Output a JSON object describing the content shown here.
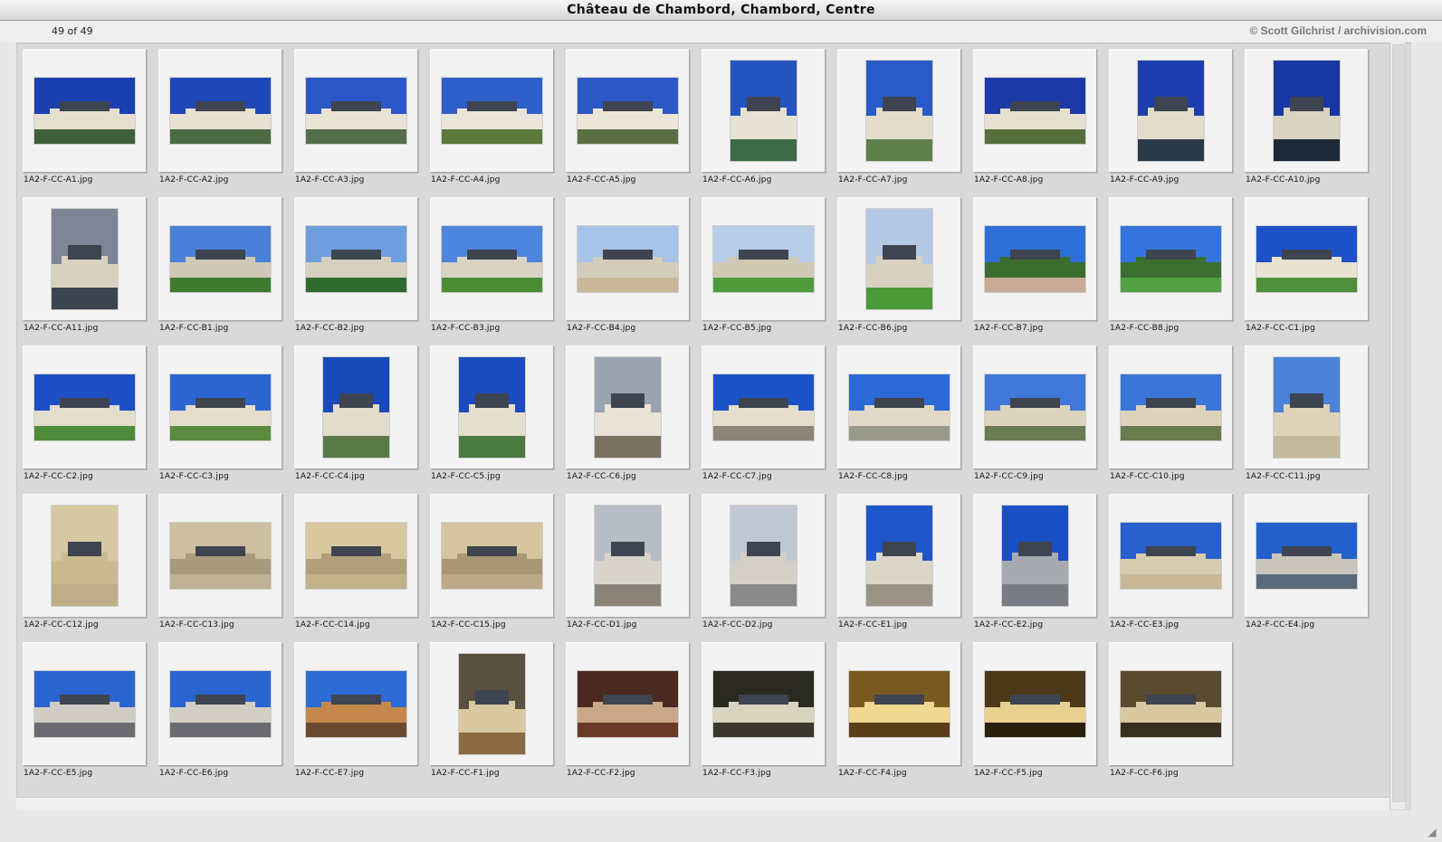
{
  "window": {
    "title": "Château de Chambord, Chambord, Centre"
  },
  "toolbar": {
    "count": "49 of 49",
    "credit": "© Scott Gilchrist / archivision.com"
  },
  "thumbnails": [
    {
      "file": "1A2-F-CC-A1.jpg",
      "orientation": "landscape",
      "sky": "#1c3fb0",
      "ground": "#3f5f3a",
      "building": "#e5dfd0"
    },
    {
      "file": "1A2-F-CC-A2.jpg",
      "orientation": "landscape",
      "sky": "#1f47b8",
      "ground": "#4b6b45",
      "building": "#e7e1d2"
    },
    {
      "file": "1A2-F-CC-A3.jpg",
      "orientation": "landscape",
      "sky": "#2a57c8",
      "ground": "#536f49",
      "building": "#e9e3d5"
    },
    {
      "file": "1A2-F-CC-A4.jpg",
      "orientation": "landscape",
      "sky": "#2f5fc8",
      "ground": "#5b7a3b",
      "building": "#eae5d8"
    },
    {
      "file": "1A2-F-CC-A5.jpg",
      "orientation": "landscape",
      "sky": "#2a58c4",
      "ground": "#5a6e44",
      "building": "#ece6d9"
    },
    {
      "file": "1A2-F-CC-A6.jpg",
      "orientation": "portrait",
      "sky": "#2454c0",
      "ground": "#3e6b48",
      "building": "#e8e2d4"
    },
    {
      "file": "1A2-F-CC-A7.jpg",
      "orientation": "portrait",
      "sky": "#2a5ac8",
      "ground": "#5f7f4a",
      "building": "#e3dccb"
    },
    {
      "file": "1A2-F-CC-A8.jpg",
      "orientation": "landscape",
      "sky": "#1b3aa8",
      "ground": "#55703c",
      "building": "#e6e0d0"
    },
    {
      "file": "1A2-F-CC-A9.jpg",
      "orientation": "portrait",
      "sky": "#1d3fae",
      "ground": "#2b3a48",
      "building": "#e1dbcb"
    },
    {
      "file": "1A2-F-CC-A10.jpg",
      "orientation": "portrait",
      "sky": "#1738a2",
      "ground": "#1c2a38",
      "building": "#d9d3c2"
    },
    {
      "file": "1A2-F-CC-A11.jpg",
      "orientation": "portrait",
      "sky": "#7d8596",
      "ground": "#3a4550",
      "building": "#d8d1bf"
    },
    {
      "file": "1A2-F-CC-B1.jpg",
      "orientation": "landscape",
      "sky": "#4b80d8",
      "ground": "#3f7a30",
      "building": "#cfc8b6"
    },
    {
      "file": "1A2-F-CC-B2.jpg",
      "orientation": "landscape",
      "sky": "#6f9ee0",
      "ground": "#2f6a2e",
      "building": "#d6d0c0"
    },
    {
      "file": "1A2-F-CC-B3.jpg",
      "orientation": "landscape",
      "sky": "#4d86dc",
      "ground": "#4c8c34",
      "building": "#d9d3c3"
    },
    {
      "file": "1A2-F-CC-B4.jpg",
      "orientation": "landscape",
      "sky": "#a7c4e8",
      "ground": "#c9b89a",
      "building": "#d3ccba"
    },
    {
      "file": "1A2-F-CC-B5.jpg",
      "orientation": "landscape",
      "sky": "#b8cde8",
      "ground": "#4f9b3c",
      "building": "#cfc8b5"
    },
    {
      "file": "1A2-F-CC-B6.jpg",
      "orientation": "portrait",
      "sky": "#b5c8e4",
      "ground": "#4a9a3a",
      "building": "#d8d1c0"
    },
    {
      "file": "1A2-F-CC-B7.jpg",
      "orientation": "landscape",
      "sky": "#2f6fd8",
      "ground": "#c9aa96",
      "building": "#3b6e2e"
    },
    {
      "file": "1A2-F-CC-B8.jpg",
      "orientation": "landscape",
      "sky": "#3474dc",
      "ground": "#54a044",
      "building": "#3a6f2f"
    },
    {
      "file": "1A2-F-CC-C1.jpg",
      "orientation": "landscape",
      "sky": "#1f52c8",
      "ground": "#4d8f3b",
      "building": "#e8e2d2"
    },
    {
      "file": "1A2-F-CC-C2.jpg",
      "orientation": "landscape",
      "sky": "#1e4fc4",
      "ground": "#4d8a3a",
      "building": "#e3ddcd"
    },
    {
      "file": "1A2-F-CC-C3.jpg",
      "orientation": "landscape",
      "sky": "#2d66d2",
      "ground": "#5a8a40",
      "building": "#e4ddcb"
    },
    {
      "file": "1A2-F-CC-C4.jpg",
      "orientation": "portrait",
      "sky": "#1a49b8",
      "ground": "#5a7a4a",
      "building": "#e2dccb"
    },
    {
      "file": "1A2-F-CC-C5.jpg",
      "orientation": "portrait",
      "sky": "#1b4bbc",
      "ground": "#4a7a40",
      "building": "#e4decd"
    },
    {
      "file": "1A2-F-CC-C6.jpg",
      "orientation": "portrait",
      "sky": "#9aa4b0",
      "ground": "#7a7060",
      "building": "#e8e3d6"
    },
    {
      "file": "1A2-F-CC-C7.jpg",
      "orientation": "landscape",
      "sky": "#1c52c8",
      "ground": "#8d8678",
      "building": "#e4ddcb"
    },
    {
      "file": "1A2-F-CC-C8.jpg",
      "orientation": "landscape",
      "sky": "#2b6ad6",
      "ground": "#9a9a8a",
      "building": "#e1dac8"
    },
    {
      "file": "1A2-F-CC-C9.jpg",
      "orientation": "landscape",
      "sky": "#3f78d8",
      "ground": "#6a7a52",
      "building": "#ddd4bd"
    },
    {
      "file": "1A2-F-CC-C10.jpg",
      "orientation": "landscape",
      "sky": "#3a76d8",
      "ground": "#6c7a50",
      "building": "#ddd3bb"
    },
    {
      "file": "1A2-F-CC-C11.jpg",
      "orientation": "portrait",
      "sky": "#4c82d8",
      "ground": "#c4b89c",
      "building": "#ddd3b9"
    },
    {
      "file": "1A2-F-CC-C12.jpg",
      "orientation": "portrait",
      "sky": "#d6c8a2",
      "ground": "#bfae88",
      "building": "#cbb990"
    },
    {
      "file": "1A2-F-CC-C13.jpg",
      "orientation": "landscape",
      "sky": "#cdbfa0",
      "ground": "#bfb194",
      "building": "#a89a7c"
    },
    {
      "file": "1A2-F-CC-C14.jpg",
      "orientation": "landscape",
      "sky": "#d8c8a0",
      "ground": "#c2b28a",
      "building": "#b0a07a"
    },
    {
      "file": "1A2-F-CC-C15.jpg",
      "orientation": "landscape",
      "sky": "#d5c59e",
      "ground": "#bca986",
      "building": "#a89674"
    },
    {
      "file": "1A2-F-CC-D1.jpg",
      "orientation": "portrait",
      "sky": "#b8bcc4",
      "ground": "#8a8478",
      "building": "#d8d4cc"
    },
    {
      "file": "1A2-F-CC-D2.jpg",
      "orientation": "portrait",
      "sky": "#c0c8d4",
      "ground": "#8a8a8a",
      "building": "#d4d0c8"
    },
    {
      "file": "1A2-F-CC-E1.jpg",
      "orientation": "portrait",
      "sky": "#1f56cc",
      "ground": "#9a9488",
      "building": "#dcd6c8"
    },
    {
      "file": "1A2-F-CC-E2.jpg",
      "orientation": "portrait",
      "sky": "#1a50c4",
      "ground": "#7a7c84",
      "building": "#a8aab2"
    },
    {
      "file": "1A2-F-CC-E3.jpg",
      "orientation": "landscape",
      "sky": "#2860cc",
      "ground": "#c8b898",
      "building": "#d8ccb0"
    },
    {
      "file": "1A2-F-CC-E4.jpg",
      "orientation": "landscape",
      "sky": "#2460cc",
      "ground": "#5a6a7a",
      "building": "#c8c4bc"
    },
    {
      "file": "1A2-F-CC-E5.jpg",
      "orientation": "landscape",
      "sky": "#2a64d0",
      "ground": "#6a6a70",
      "building": "#d0ccc4"
    },
    {
      "file": "1A2-F-CC-E6.jpg",
      "orientation": "landscape",
      "sky": "#2a64d0",
      "ground": "#6a6a70",
      "building": "#d2cec4"
    },
    {
      "file": "1A2-F-CC-E7.jpg",
      "orientation": "landscape",
      "sky": "#2c6ad4",
      "ground": "#6a4a30",
      "building": "#c4884c"
    },
    {
      "file": "1A2-F-CC-F1.jpg",
      "orientation": "portrait",
      "sky": "#5a5040",
      "ground": "#8a6a40",
      "building": "#d8c8a0"
    },
    {
      "file": "1A2-F-CC-F2.jpg",
      "orientation": "landscape",
      "sky": "#4a2a20",
      "ground": "#6a3a28",
      "building": "#c8a888"
    },
    {
      "file": "1A2-F-CC-F3.jpg",
      "orientation": "landscape",
      "sky": "#2a2a22",
      "ground": "#3a362c",
      "building": "#d8d4c0"
    },
    {
      "file": "1A2-F-CC-F4.jpg",
      "orientation": "landscape",
      "sky": "#7a5a20",
      "ground": "#5a4018",
      "building": "#f0d890"
    },
    {
      "file": "1A2-F-CC-F5.jpg",
      "orientation": "landscape",
      "sky": "#4a3818",
      "ground": "#2a1e0c",
      "building": "#e8d090"
    },
    {
      "file": "1A2-F-CC-F6.jpg",
      "orientation": "landscape",
      "sky": "#5a4a30",
      "ground": "#3a3020",
      "building": "#d8c8a0"
    }
  ]
}
